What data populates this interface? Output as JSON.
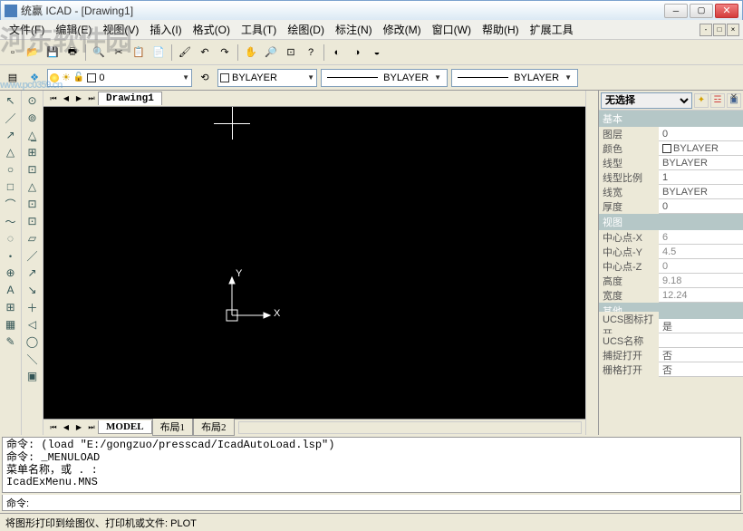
{
  "window": {
    "title": "统赢 ICAD            - [Drawing1]"
  },
  "menu": [
    "文件(F)",
    "编辑(E)",
    "视图(V)",
    "插入(I)",
    "格式(O)",
    "工具(T)",
    "绘图(D)",
    "标注(N)",
    "修改(M)",
    "窗口(W)",
    "帮助(H)",
    "扩展工具"
  ],
  "toolbar1_icons": [
    "new-icon",
    "open-icon",
    "save-icon",
    "print-icon",
    "preview-icon",
    "cut-icon",
    "copy-icon",
    "paste-icon",
    "matchprop-icon",
    "undo-icon",
    "redo-icon",
    "pan-icon",
    "zoom-icon",
    "zoom-ext-icon",
    "help-icon",
    "extra1-icon",
    "extra2-icon",
    "extra3-icon"
  ],
  "layerbar": {
    "layer_name": "0",
    "color_label": "BYLAYER",
    "linetype_label": "BYLAYER",
    "lineweight_label": "BYLAYER"
  },
  "doc_tabs": {
    "active": "Drawing1"
  },
  "layout_tabs": [
    "MODEL",
    "布局1",
    "布局2"
  ],
  "left_tools": [
    "↖",
    "／",
    "↗",
    "△",
    "○",
    "□",
    "⌒",
    "～",
    "◌",
    "・",
    "⊕",
    "A",
    "⊞",
    "▦",
    "✎"
  ],
  "left_tools2": [
    "⊙",
    "⊚",
    "△̲",
    "⊞",
    "⊡",
    "△",
    "⊡",
    "⊡",
    "▱",
    "／",
    "↗",
    "↘",
    "＋",
    "◁",
    "◯",
    "＼",
    "▣"
  ],
  "ucs": {
    "x": "X",
    "y": "Y"
  },
  "props": {
    "selector": "无选择",
    "sections": [
      {
        "title": "基本",
        "rows": [
          {
            "k": "图层",
            "v": "0"
          },
          {
            "k": "颜色",
            "v": "BYLAYER",
            "sw": true
          },
          {
            "k": "线型",
            "v": "BYLAYER"
          },
          {
            "k": "线型比例",
            "v": "1"
          },
          {
            "k": "线宽",
            "v": "BYLAYER"
          },
          {
            "k": "厚度",
            "v": "0"
          }
        ]
      },
      {
        "title": "视图",
        "rows": [
          {
            "k": "中心点-X",
            "v": "6",
            "ro": true
          },
          {
            "k": "中心点-Y",
            "v": "4.5",
            "ro": true
          },
          {
            "k": "中心点-Z",
            "v": "0",
            "ro": true
          },
          {
            "k": "高度",
            "v": "9.18",
            "ro": true
          },
          {
            "k": "宽度",
            "v": "12.24",
            "ro": true
          }
        ]
      },
      {
        "title": "其他",
        "rows": [
          {
            "k": "UCS图标打开",
            "v": "是"
          },
          {
            "k": "UCS名称",
            "v": ""
          },
          {
            "k": "捕捉打开",
            "v": "否"
          },
          {
            "k": "栅格打开",
            "v": "否"
          }
        ]
      }
    ]
  },
  "command": {
    "history": [
      "命令: (load \"E:/gongzuo/presscad/IcadAutoLoad.lsp\")",
      "命令: _MENULOAD",
      "菜单名称，或 . :",
      "IcadExMenu.MNS"
    ],
    "prompt": "命令: "
  },
  "status": "将图形打印到绘图仪、打印机或文件:  PLOT",
  "watermark": {
    "cn": "河东软件园",
    "url": "www.pc0359.cn"
  }
}
